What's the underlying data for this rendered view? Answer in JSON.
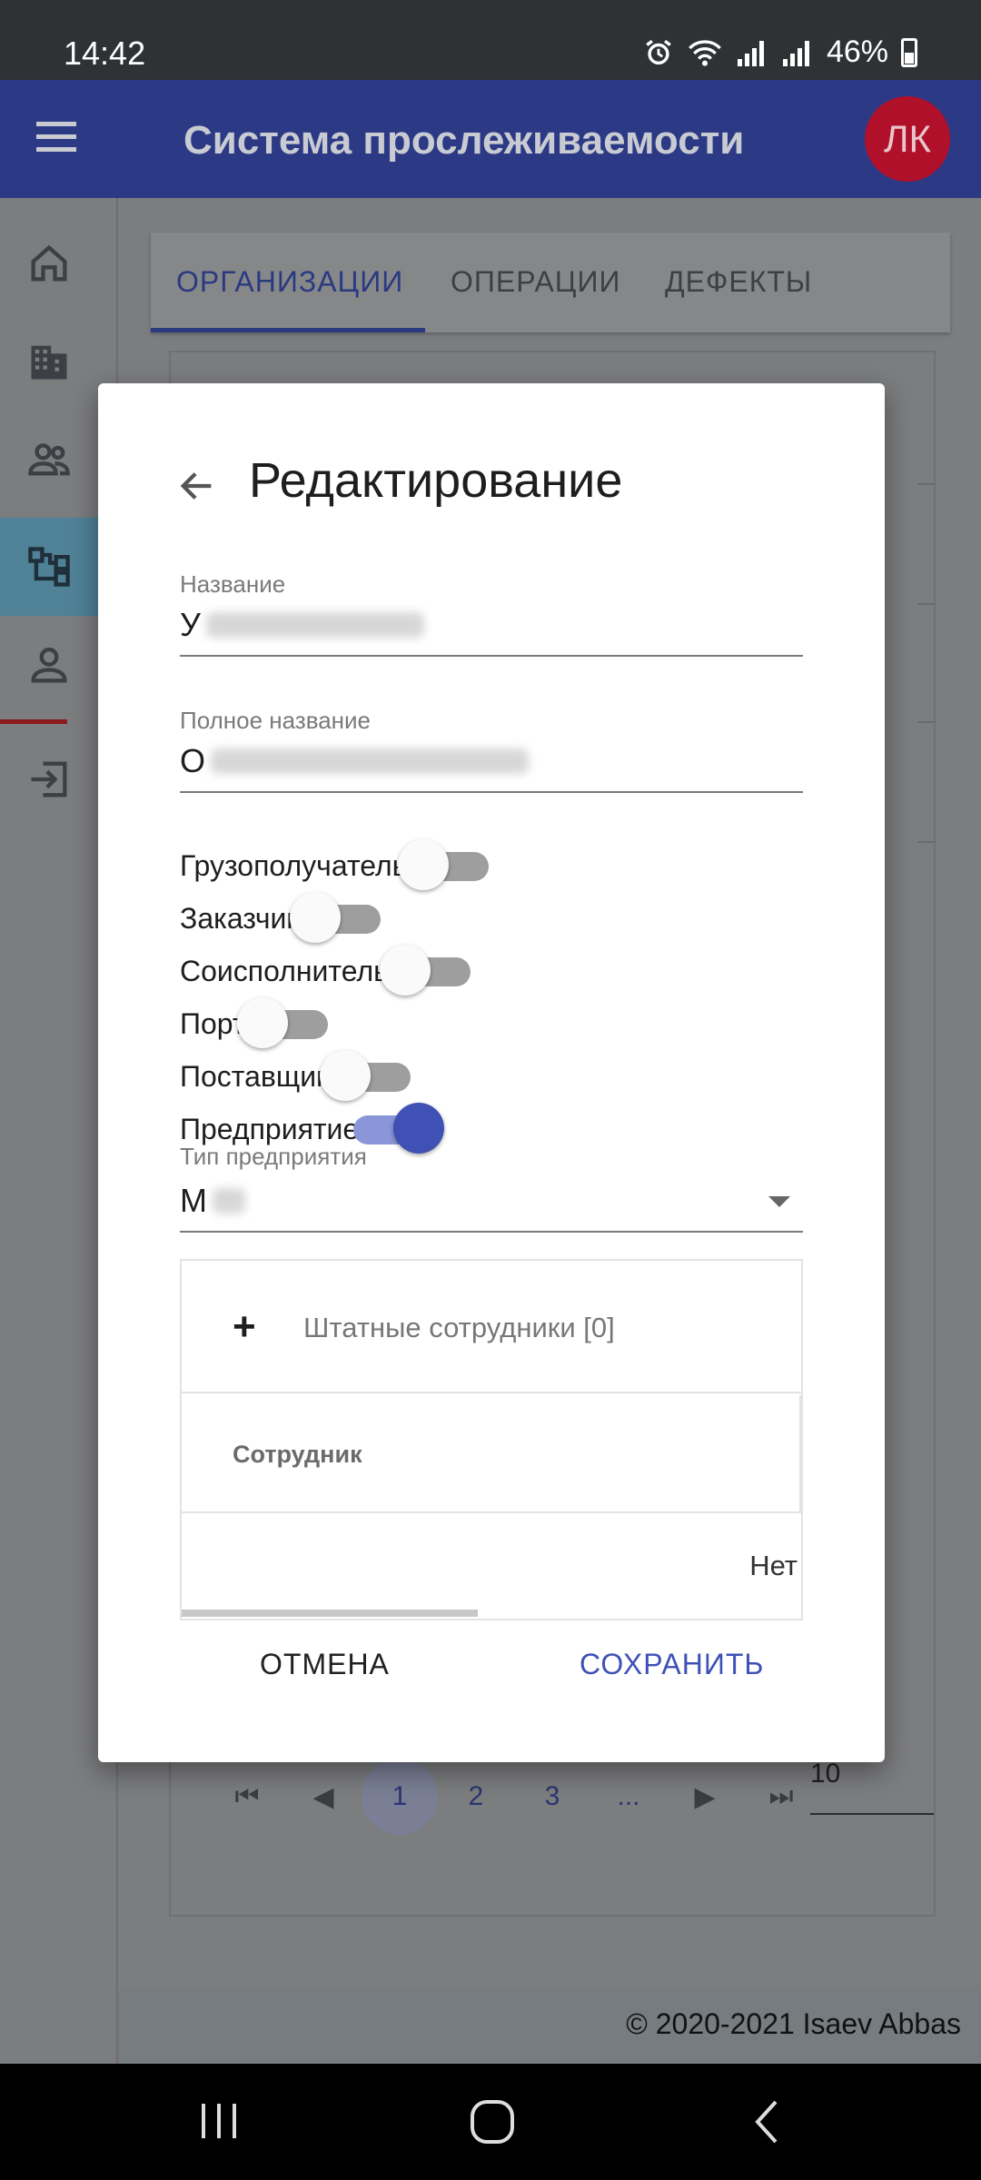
{
  "status_bar": {
    "time": "14:42",
    "battery": "46%"
  },
  "app_bar": {
    "title": "Система прослеживаемости",
    "avatar_initials": "ЛК"
  },
  "sidebar": {
    "items": [
      {
        "icon": "home-icon"
      },
      {
        "icon": "building-icon"
      },
      {
        "icon": "people-icon"
      },
      {
        "icon": "hierarchy-icon",
        "active": true
      },
      {
        "icon": "person-icon"
      },
      {
        "icon": "logout-icon"
      }
    ]
  },
  "tabs": [
    {
      "label": "ОРГАНИЗАЦИИ",
      "active": true
    },
    {
      "label": "ОПЕРАЦИИ"
    },
    {
      "label": "ДЕФЕКТЫ"
    }
  ],
  "pagination": {
    "pages": [
      "1",
      "2",
      "3",
      "..."
    ],
    "current": "1",
    "page_size": "10"
  },
  "footer": {
    "copyright": "© 2020-2021 Isaev Abbas"
  },
  "dialog": {
    "title": "Редактирование",
    "name": {
      "label": "Название",
      "value_visible": "У"
    },
    "full_name": {
      "label": "Полное название",
      "value_visible": "О"
    },
    "switches": [
      {
        "label": "Грузополучатель",
        "checked": false
      },
      {
        "label": "Заказчик",
        "checked": false
      },
      {
        "label": "Соисполнитель",
        "checked": false
      },
      {
        "label": "Порт",
        "checked": false
      },
      {
        "label": "Поставщик",
        "checked": false
      },
      {
        "label": "Предприятие",
        "checked": true
      }
    ],
    "enterprise_type": {
      "label": "Тип предприятия",
      "value_visible": "М"
    },
    "staff": {
      "title": "Штатные сотрудники [0]",
      "column": "Сотрудник",
      "empty_text": "Нет"
    },
    "cancel_label": "ОТМЕНА",
    "save_label": "СОХРАНИТЬ"
  }
}
